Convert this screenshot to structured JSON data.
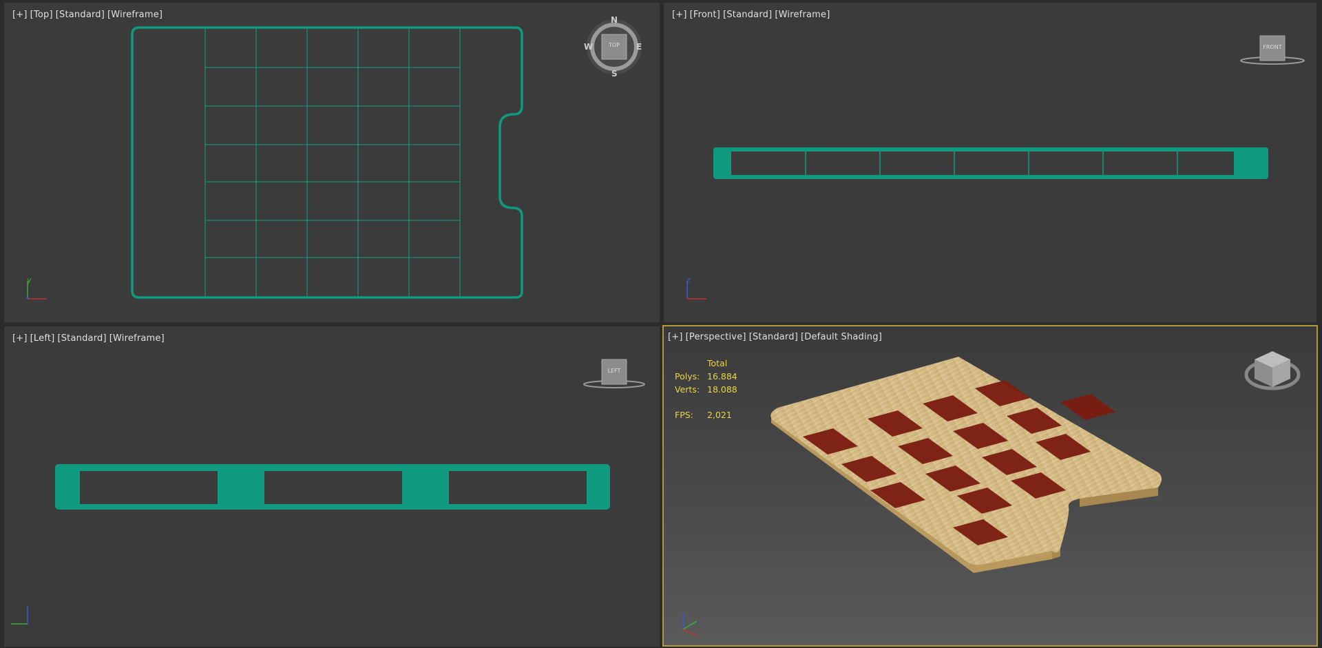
{
  "viewports": {
    "top": {
      "tokens": [
        "[+]",
        "[Top]",
        "[Standard]",
        "[Wireframe]"
      ],
      "compass": {
        "n": "N",
        "s": "S",
        "e": "E",
        "w": "W",
        "cube": "TOP"
      }
    },
    "front": {
      "tokens": [
        "[+]",
        "[Front]",
        "[Standard]",
        "[Wireframe]"
      ],
      "cube": "FRONT"
    },
    "left": {
      "tokens": [
        "[+]",
        "[Left]",
        "[Standard]",
        "[Wireframe]"
      ],
      "cube": "LEFT"
    },
    "perspective": {
      "tokens": [
        "[+]",
        "[Perspective]",
        "[Standard]",
        "[Default Shading]"
      ]
    }
  },
  "stats": {
    "header": "Total",
    "polys_label": "Polys:",
    "polys": "16.884",
    "verts_label": "Verts:",
    "verts": "18.088",
    "fps_label": "FPS:",
    "fps": "2,021"
  },
  "axes": {
    "x": "x",
    "y": "y",
    "z": "z"
  },
  "colors": {
    "wire": "#0f9a80",
    "viewport_bg": "#3b3b3b",
    "active_border": "#b4993a",
    "stats_text": "#e8d64a",
    "wood_light": "#d8bf8c",
    "wood_dark": "#7a1c10"
  }
}
